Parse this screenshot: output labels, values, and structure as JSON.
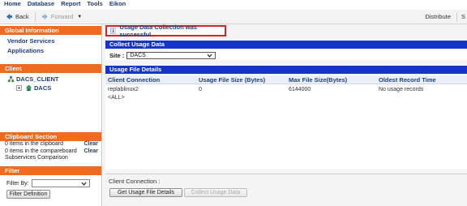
{
  "menu": {
    "items": [
      "Home",
      "Database",
      "Report",
      "Tools",
      "Eikon"
    ]
  },
  "toolbar": {
    "back_label": "Back",
    "forward_label": "Forward",
    "distribute_label": "Distribute",
    "overflow_label": "S"
  },
  "left": {
    "global_info": {
      "title": "Global Information",
      "links": [
        "Vendor Services",
        "Applications"
      ]
    },
    "client": {
      "title": "Client",
      "tree_root": "DACS_CLIENT",
      "tree_child": "DACS"
    },
    "clipboard": {
      "title": "Clipboard Section",
      "rows": [
        {
          "text": "0 items in the clipboard",
          "action": "Clear"
        },
        {
          "text": "0 items in the compareboard",
          "action": "Clear"
        },
        {
          "text": "Subservices Comparison",
          "action": ""
        }
      ]
    },
    "filter": {
      "title": "Filter",
      "filter_by_label": "Filter By:",
      "filter_by_value": "",
      "definition_button": "Filter Definition"
    }
  },
  "main": {
    "notice": "Usage Data Collection was successful.",
    "collect_title": "Collect Usage Data",
    "site_label": "Site :",
    "site_value": "DACS",
    "details_title": "Usage File Details",
    "columns": [
      "Client Connection",
      "Usage File Size (Bytes)",
      "Max File Size(Bytes)",
      "Oldest Record Time"
    ],
    "rows": [
      [
        "replablinux2",
        "0",
        "6144000",
        "No usage records"
      ],
      [
        "<ALL>",
        "",
        "",
        ""
      ]
    ],
    "client_connection_label": "Client Connection :",
    "get_details_button": "Get Usage File Details",
    "collect_button": "Collect Usage Data"
  },
  "colors": {
    "orange_header": "#ee6b1f",
    "blue_header": "#1534c8",
    "link_blue": "#1f3f7a",
    "notice_border": "#d9232b"
  }
}
